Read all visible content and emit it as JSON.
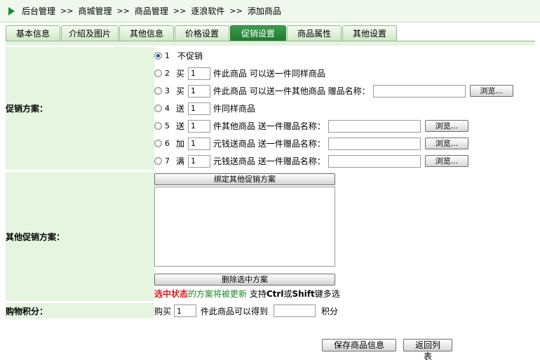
{
  "breadcrumb": [
    "后台管理",
    "商城管理",
    "商品管理",
    "逐浪软件",
    "添加商品"
  ],
  "breadcrumb_sep": ">>",
  "tabs": [
    "基本信息",
    "介绍及图片",
    "其他信息",
    "价格设置",
    "促销设置",
    "商品属性",
    "其他设置"
  ],
  "active_tab": "促销设置",
  "promo": {
    "label": "促销方案：",
    "options": [
      {
        "num": "1",
        "verb": "",
        "text": "不促销"
      },
      {
        "num": "2",
        "verb": "买",
        "value": "1",
        "text": "件此商品 可以送一件同样商品"
      },
      {
        "num": "3",
        "verb": "买",
        "value": "1",
        "text": "件此商品 可以送一件其他商品 赠品名称：",
        "browse": "浏览..."
      },
      {
        "num": "4",
        "verb": "送",
        "value": "1",
        "text": "件同样商品"
      },
      {
        "num": "5",
        "verb": "送",
        "value": "1",
        "text": "件其他商品 送一件赠品名称：",
        "browse": "浏览..."
      },
      {
        "num": "6",
        "verb": "加",
        "value": "1",
        "text": "元钱送商品 送一件赠品名称：",
        "browse": "浏览..."
      },
      {
        "num": "7",
        "verb": "满",
        "value": "1",
        "text": "元钱送商品 送一件赠品名称：",
        "browse": "浏览..."
      }
    ]
  },
  "other": {
    "label": "其他促销方案：",
    "bind_button": "绑定其他促销方案",
    "delete_button": "删除选中方案",
    "hint_red": "选中状态",
    "hint_green1": "的方案将被更新",
    "hint_mid": " 支持",
    "hint_ctrl": "Ctrl",
    "hint_or": "或",
    "hint_shift": "Shift",
    "hint_end": "键多选"
  },
  "points": {
    "label": "购物积分：",
    "pre": "购买",
    "value": "1",
    "mid": "件此商品可以得到",
    "points_value": "",
    "post": "积分"
  },
  "footer": {
    "save": "保存商品信息",
    "back": "返回列表"
  },
  "colors": {
    "label_bg": "#e5f5e0",
    "active_tab": "#217a31",
    "hint_red": "#e01818",
    "hint_green": "#1d8a2a"
  }
}
